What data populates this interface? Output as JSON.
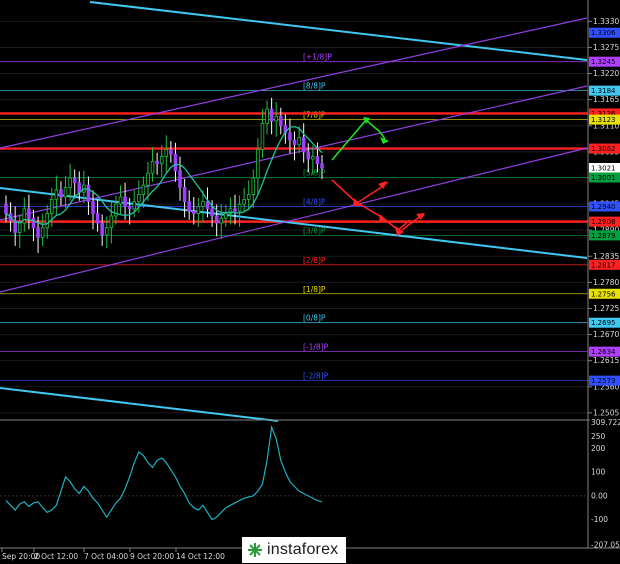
{
  "brand": {
    "name": "instaforex"
  },
  "chart_data": [
    {
      "type": "candlestick",
      "ylim": [
        1.249,
        1.3375
      ],
      "price_labels": [
        "1.3330",
        "1.3275",
        "1.3220",
        "1.3165",
        "1.3110",
        "1.3055",
        "1.3000",
        "1.2945",
        "1.2890",
        "1.2835",
        "1.2780",
        "1.2725",
        "1.2670",
        "1.2615",
        "1.2560",
        "1.2505"
      ],
      "price_ticks": [
        1.333,
        1.3275,
        1.322,
        1.3165,
        1.311,
        1.3055,
        1.3,
        1.2945,
        1.289,
        1.2835,
        1.278,
        1.2725,
        1.267,
        1.2615,
        1.256,
        1.2505
      ],
      "murrey_levels": [
        {
          "label": "[+1/8]P",
          "price": 1.3245,
          "color": "#b040ff"
        },
        {
          "label": "[8/8]P",
          "price": 1.3184,
          "color": "#40c8f0"
        },
        {
          "label": "[7/8]P",
          "price": 1.3123,
          "color": "#e8e000"
        },
        {
          "label": "[5/8]P",
          "price": 1.3001,
          "color": "#00a040"
        },
        {
          "label": "[4/8]P",
          "price": 1.294,
          "color": "#3050ff"
        },
        {
          "label": "[3/8]P",
          "price": 1.2879,
          "color": "#00a040"
        },
        {
          "label": "[2/8]P",
          "price": 1.2817,
          "color": "#ff2020"
        },
        {
          "label": "[1/8]P",
          "price": 1.2756,
          "color": "#e8e000"
        },
        {
          "label": "[0/8]P",
          "price": 1.2695,
          "color": "#40c8f0"
        },
        {
          "label": "[-1/8]P",
          "price": 1.2634,
          "color": "#b040ff"
        },
        {
          "label": "[-2/8]P",
          "price": 1.2573,
          "color": "#3050ff"
        }
      ],
      "badges": [
        {
          "text": "1.3306",
          "price": 1.3306,
          "color": "#3050ff"
        },
        {
          "text": "1.3245",
          "price": 1.3245,
          "color": "#b040ff"
        },
        {
          "text": "1.3184",
          "price": 1.3184,
          "color": "#40c8f0"
        },
        {
          "text": "1.3136",
          "price": 1.3136,
          "color": "#ff2020"
        },
        {
          "text": "1.3123",
          "price": 1.3123,
          "color": "#e8e000"
        },
        {
          "text": "1.3062",
          "price": 1.3062,
          "color": "#ff2020"
        },
        {
          "text": "1.3021",
          "price": 1.3021,
          "color": "#ffffff"
        },
        {
          "text": "1.3001",
          "price": 1.3001,
          "color": "#00a040"
        },
        {
          "text": "1.2940",
          "price": 1.294,
          "color": "#3050ff"
        },
        {
          "text": "1.2908",
          "price": 1.2908,
          "color": "#ff2020"
        },
        {
          "text": "1.2879",
          "price": 1.2879,
          "color": "#00a040"
        },
        {
          "text": "1.2817",
          "price": 1.2817,
          "color": "#ff2020"
        },
        {
          "text": "1.2756",
          "price": 1.2756,
          "color": "#e8e000"
        },
        {
          "text": "1.2695",
          "price": 1.2695,
          "color": "#40c8f0"
        },
        {
          "text": "1.2634",
          "price": 1.2634,
          "color": "#b040ff"
        },
        {
          "text": "1.2573",
          "price": 1.2573,
          "color": "#3050ff"
        }
      ],
      "horizontal_lines": [
        {
          "price": 1.3136,
          "color": "#ff2020"
        },
        {
          "price": 1.3062,
          "color": "#ff2020"
        },
        {
          "price": 1.2908,
          "color": "#ff2020"
        }
      ],
      "time_labels": [
        "Sep 20:00",
        "2 Oct 12:00",
        "7 Oct 04:00",
        "9 Oct 20:00",
        "14 Oct 12:00"
      ],
      "candles_close": [
        1.2925,
        1.291,
        1.2885,
        1.2905,
        1.2935,
        1.2915,
        1.2895,
        1.2875,
        1.2895,
        1.2925,
        1.2955,
        1.2975,
        1.296,
        1.298,
        1.3,
        1.299,
        1.297,
        1.2985,
        1.295,
        1.2925,
        1.2905,
        1.288,
        1.2895,
        1.292,
        1.2945,
        1.296,
        1.294,
        1.2935,
        1.295,
        1.2965,
        1.2985,
        1.301,
        1.3035,
        1.303,
        1.3045,
        1.306,
        1.305,
        1.3015,
        1.298,
        1.295,
        1.293,
        1.2925,
        1.294,
        1.295,
        1.2935,
        1.292,
        1.2905,
        1.2915,
        1.2925,
        1.2935,
        1.293,
        1.2945,
        1.2955,
        1.2965,
        1.3,
        1.306,
        1.3115,
        1.3145,
        1.312,
        1.313,
        1.311,
        1.3095,
        1.308,
        1.307,
        1.3085,
        1.3055,
        1.304,
        1.3045,
        1.303,
        1.3021
      ]
    },
    {
      "type": "line",
      "name": "oscillator",
      "ylim": [
        -220,
        320
      ],
      "value_labels": [
        "309.7227",
        "250",
        "200",
        "100",
        "0.00",
        "-100",
        "-207.059"
      ],
      "value_ticks": [
        309.7227,
        250,
        200,
        100,
        0,
        -100,
        -207.059
      ],
      "values": [
        -20,
        -40,
        -60,
        -35,
        -25,
        -45,
        -30,
        -25,
        -50,
        -70,
        -60,
        -40,
        20,
        80,
        60,
        30,
        10,
        40,
        20,
        -10,
        -30,
        -60,
        -90,
        -60,
        -30,
        -10,
        30,
        80,
        140,
        185,
        170,
        140,
        120,
        150,
        160,
        140,
        110,
        80,
        40,
        10,
        -30,
        -50,
        -60,
        -40,
        -70,
        -100,
        -90,
        -70,
        -50,
        -40,
        -30,
        -20,
        -10,
        -5,
        0,
        20,
        50,
        150,
        290,
        240,
        150,
        100,
        60,
        40,
        20,
        10,
        0,
        -10,
        -20,
        -25
      ]
    }
  ]
}
